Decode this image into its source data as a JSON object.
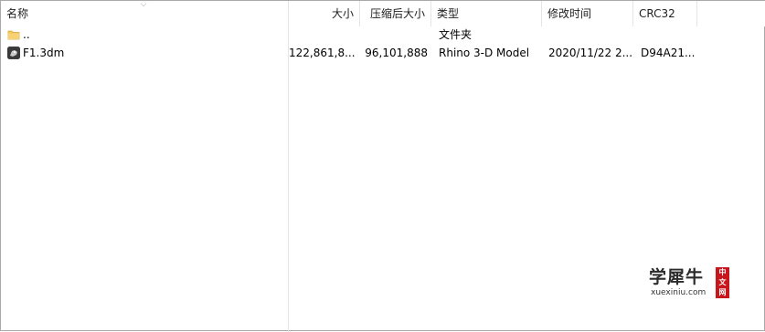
{
  "columns": {
    "name": "名称",
    "size": "大小",
    "packed": "压缩后大小",
    "type": "类型",
    "modified": "修改时间",
    "crc": "CRC32"
  },
  "rows": [
    {
      "icon": "folder-icon",
      "name": "..",
      "size": "",
      "packed": "",
      "type": "文件夹",
      "modified": "",
      "crc": ""
    },
    {
      "icon": "rhino-file-icon",
      "name": "F1.3dm",
      "size": "122,861,8...",
      "packed": "96,101,888",
      "type": "Rhino 3-D Model",
      "modified": "2020/11/22 2...",
      "crc": "D94A21..."
    }
  ],
  "watermark": {
    "title": "学犀牛",
    "url": "xuexiniu.com",
    "badge": [
      "中",
      "文",
      "网"
    ]
  },
  "colors": {
    "folder": "#f3c55c",
    "badge": "#c8161d"
  }
}
